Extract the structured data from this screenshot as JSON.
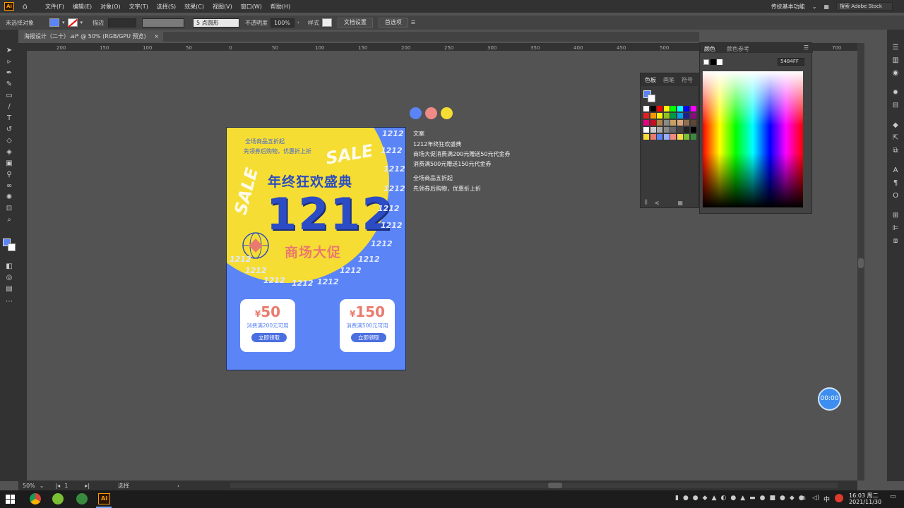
{
  "menubar": {
    "logo": "Ai",
    "menus": [
      "文件(F)",
      "编辑(E)",
      "对象(O)",
      "文字(T)",
      "选择(S)",
      "效果(C)",
      "视图(V)",
      "窗口(W)",
      "帮助(H)"
    ],
    "workspace": "传统基本功能",
    "search_placeholder": "搜索 Adobe Stock"
  },
  "controlbar": {
    "selection": "未选择对象",
    "stroke_label": "描边",
    "brush_label": "5 点圆形",
    "opacity_label": "不透明度",
    "opacity_value": "100%",
    "style_label": "样式",
    "doc_settings": "文档设置",
    "preferences": "首选项"
  },
  "document": {
    "tab_title": "海报设计（二十）.ai* @ 50% (RGB/GPU 预览)",
    "close": "×"
  },
  "ruler": {
    "ticks": [
      "200",
      "150",
      "100",
      "50",
      "0",
      "50",
      "100",
      "150",
      "200",
      "250",
      "300",
      "350",
      "400",
      "450",
      "500",
      "550",
      "600",
      "650",
      "700"
    ]
  },
  "poster": {
    "top_line1": "全场商品五折起",
    "top_line2": "先领券后购物，优惠折上折",
    "headline": "年终狂欢盛典",
    "number": "1212",
    "subhead": "商场大促",
    "sale_word": "SALE",
    "mini_tag": "1212",
    "coupons": [
      {
        "price": "50",
        "currency": "¥",
        "note": "消费满200元可用",
        "button": "立即领取"
      },
      {
        "price": "150",
        "currency": "¥",
        "note": "消费满500元可用",
        "button": "立即领取"
      }
    ],
    "colors": {
      "blue": "#5B84F6",
      "yellow": "#F6DD33",
      "coral": "#EA7A6E"
    }
  },
  "palette_dots": [
    "#5B84F6",
    "#F08A86",
    "#F6DD33"
  ],
  "copy_text": {
    "heading": "文案",
    "line1": "1212年终狂欢盛典",
    "line2": "商场大促消费满200元赠送50元代金券",
    "line3": "消费满500元赠送150元代金券",
    "line4": "全场商品五折起",
    "line5": "先领券后购物，优惠折上折"
  },
  "swatch_panel": {
    "tabs": [
      "色板",
      "画笔",
      "符号"
    ]
  },
  "color_panel": {
    "tabs": [
      "颜色",
      "颜色参考"
    ],
    "hex": "5484FF"
  },
  "statusbar": {
    "zoom": "50%",
    "artboard": "1",
    "tool": "选择"
  },
  "timer": "00:00",
  "taskbar": {
    "ime": "中",
    "time": "16:03 周二",
    "date": "2021/11/30"
  }
}
